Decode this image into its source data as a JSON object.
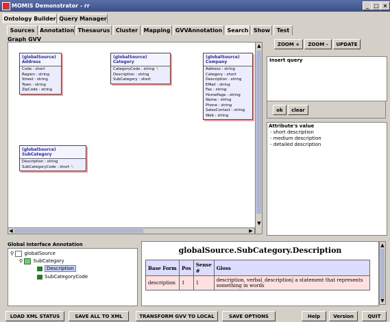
{
  "window": {
    "title": "MOMIS Demonstrator - rr",
    "controls": [
      "_",
      "□",
      "×"
    ]
  },
  "top_tabs": [
    "Ontology Builder",
    "Query Manager"
  ],
  "sub_tabs": [
    "Sources",
    "Annotation",
    "Thesaurus",
    "Cluster",
    "Mapping",
    "GVVAnnotation",
    "Search",
    "Show",
    "Test"
  ],
  "graph": {
    "title": "Graph GVV",
    "nodes": [
      {
        "kind": "(globalSource)",
        "name": "Address",
        "attrs": [
          "Code : short",
          "Region : string",
          "Street : string",
          "Town : string",
          "ZipCode : string"
        ],
        "key_icon": false
      },
      {
        "kind": "(globalSource)",
        "name": "Category",
        "attrs": [
          "CategoryCode : string",
          "Description : string",
          "SubCategory : short"
        ],
        "key_icon": true
      },
      {
        "kind": "(globalSource)",
        "name": "Company",
        "attrs": [
          "Address : string",
          "Category : short",
          "Description : string",
          "EMail : string",
          "Fax : string",
          "HomePage : string",
          "Name : string",
          "Phone : string",
          "SalesContact : string",
          "Web : string"
        ],
        "key_icon": false
      },
      {
        "kind": "(globalSource)",
        "name": "SubCategory",
        "attrs": [
          "Description : string",
          "SubCategoryCode : short"
        ],
        "key_icon": true
      }
    ]
  },
  "zoom": {
    "in": "ZOOM +",
    "out": "ZOOM -",
    "update": "UPDATE"
  },
  "query": {
    "label": "Insert query",
    "value": "",
    "ok": "ok",
    "clear": "clear"
  },
  "attr_values": {
    "label": "Attribute's value",
    "items": [
      "- short description",
      "- medium description",
      "- detailed description"
    ]
  },
  "annotation_tree": {
    "label": "Global Interface Annotation",
    "root": "globalSource",
    "child": "SubCategory",
    "leaves": [
      "Description",
      "SubCategoryCode"
    ],
    "selected": "Description"
  },
  "gloss": {
    "title": "globalSource.SubCategory.Description",
    "headers": [
      "Base Form",
      "Pos",
      "Sense #",
      "Gloss"
    ],
    "rows": [
      [
        "description",
        "1",
        "1",
        "description, verbal_description| a statement that represents something in words"
      ]
    ]
  },
  "bottom_buttons": [
    "LOAD XML STATUS",
    "SAVE ALL TO XML",
    "TRANSFORM GVV TO LOCAL",
    "SAVE OPTIONS",
    "Help",
    "Version",
    "QUIT"
  ]
}
